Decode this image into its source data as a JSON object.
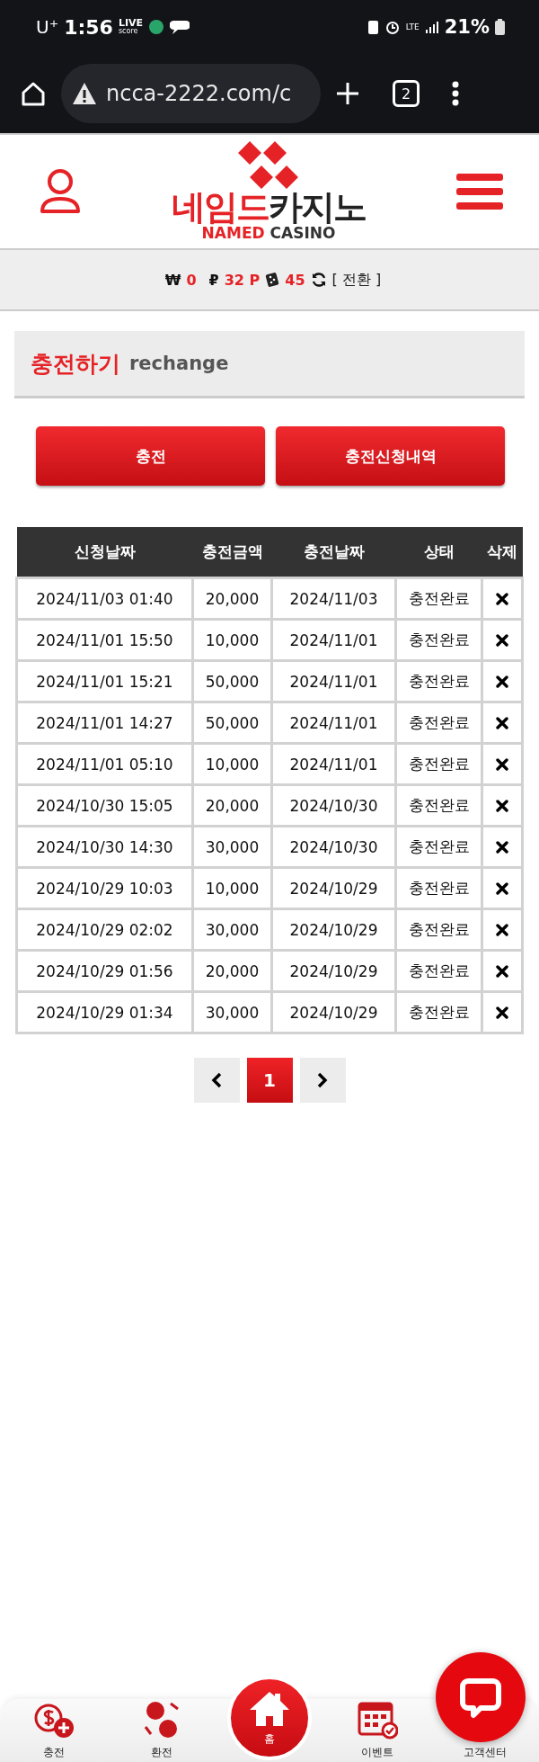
{
  "status_bar": {
    "carrier": "U⁺",
    "time": "1:56",
    "app_badge_top": "LIVE",
    "app_badge_bottom": "score",
    "network": "LTE",
    "battery": "21%"
  },
  "browser": {
    "url": "ncca-2222.com/c",
    "tab_count": "2"
  },
  "logo": {
    "korean_red": "네임드",
    "korean_dark": "카지노",
    "english_red": "NAMED",
    "english_dark": "CASINO"
  },
  "balance": [
    {
      "kind": "won",
      "symbol": "₩",
      "value": "0"
    },
    {
      "kind": "point",
      "symbol": "₽",
      "value": "32 P"
    },
    {
      "kind": "chip",
      "value": "45"
    }
  ],
  "convert_label": "[ 전환 ]",
  "section": {
    "title": "충전하기",
    "subtitle": "rechange"
  },
  "buttons": [
    "충전",
    "충전신청내역"
  ],
  "table": {
    "columns": [
      "신청날짜",
      "충전금액",
      "충전날짜",
      "상태",
      "삭제"
    ],
    "rows": [
      [
        "2024/11/03 01:40",
        "20,000",
        "2024/11/03",
        "충전완료"
      ],
      [
        "2024/11/01 15:50",
        "10,000",
        "2024/11/01",
        "충전완료"
      ],
      [
        "2024/11/01 15:21",
        "50,000",
        "2024/11/01",
        "충전완료"
      ],
      [
        "2024/11/01 14:27",
        "50,000",
        "2024/11/01",
        "충전완료"
      ],
      [
        "2024/11/01 05:10",
        "10,000",
        "2024/11/01",
        "충전완료"
      ],
      [
        "2024/10/30 15:05",
        "20,000",
        "2024/10/30",
        "충전완료"
      ],
      [
        "2024/10/30 14:30",
        "30,000",
        "2024/10/30",
        "충전완료"
      ],
      [
        "2024/10/29 10:03",
        "10,000",
        "2024/10/29",
        "충전완료"
      ],
      [
        "2024/10/29 02:02",
        "30,000",
        "2024/10/29",
        "충전완료"
      ],
      [
        "2024/10/29 01:56",
        "20,000",
        "2024/10/29",
        "충전완료"
      ],
      [
        "2024/10/29 01:34",
        "30,000",
        "2024/10/29",
        "충전완료"
      ]
    ]
  },
  "pagination": {
    "pages": [
      {
        "label": "1",
        "selected": true
      }
    ]
  },
  "bottom_nav": [
    {
      "kind": "charge",
      "label": "충전"
    },
    {
      "kind": "exchange",
      "label": "환전"
    },
    {
      "kind": "home",
      "label": "홈"
    },
    {
      "kind": "event",
      "label": "이벤트"
    },
    {
      "kind": "support",
      "label": "고객센터"
    }
  ]
}
